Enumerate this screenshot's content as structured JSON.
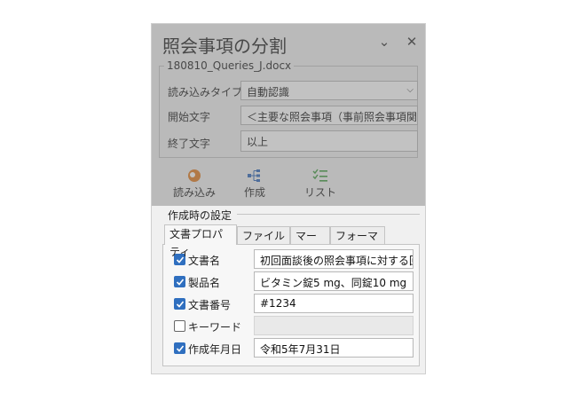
{
  "dialog": {
    "title": "照会事項の分割",
    "file_name": "180810_Queries_J.docx",
    "read_type_label": "読み込みタイプ",
    "read_type_value": "自動認識",
    "start_text_label": "開始文字",
    "start_text_value": "＜主要な照会事項（事前照会事項関連",
    "end_text_label": "終了文字",
    "end_text_value": "以上"
  },
  "toolbar": {
    "load_label": "読み込み",
    "create_label": "作成",
    "list_label": "リスト"
  },
  "settings": {
    "legend": "作成時の設定",
    "tabs": [
      {
        "label": "文書プロパティ"
      },
      {
        "label": "ファイル名"
      },
      {
        "label": "マージ"
      },
      {
        "label": "フォーマット"
      }
    ],
    "rows": [
      {
        "label": "文書名",
        "checked": true,
        "value": "初回面談後の照会事項に対する回答"
      },
      {
        "label": "製品名",
        "checked": true,
        "value": "ビタミン錠5 mg、同錠10 mg"
      },
      {
        "label": "文書番号",
        "checked": true,
        "value": "#1234"
      },
      {
        "label": "キーワード",
        "checked": false,
        "value": ""
      },
      {
        "label": "作成年月日",
        "checked": true,
        "value": "令和5年7月31日"
      }
    ]
  },
  "colors": {
    "checkbox_on": "#2f6fbf",
    "load_icon": "#e07a1f",
    "create_icon": "#2e66b8",
    "list_icon": "#3c9a3c"
  }
}
